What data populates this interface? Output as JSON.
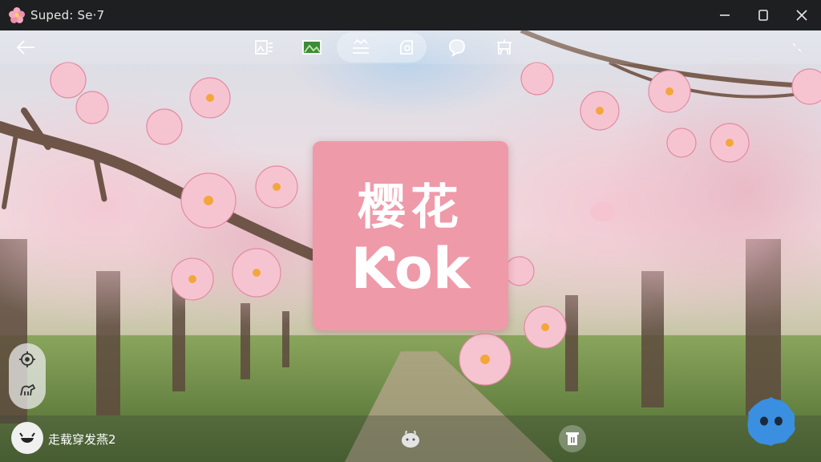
{
  "window": {
    "title": "Suped: Se·7",
    "controls": {
      "minimize": "minimize",
      "maximize": "maximize",
      "close": "close"
    }
  },
  "toolbar": {
    "icons": [
      "back-arrow-icon",
      "image-edit-icon",
      "landscape-icon",
      "filter-icon",
      "rotate-icon",
      "chat-icon",
      "crop-icon",
      "expand-icon"
    ]
  },
  "sign": {
    "line1": "樱花",
    "line2": "Ƙok"
  },
  "bottom": {
    "status": "走载穿发燕2"
  },
  "colors": {
    "sign_bg": "#ef9aa9",
    "assistant": "#3a8fe0",
    "titlebar": "#1e1f21"
  }
}
